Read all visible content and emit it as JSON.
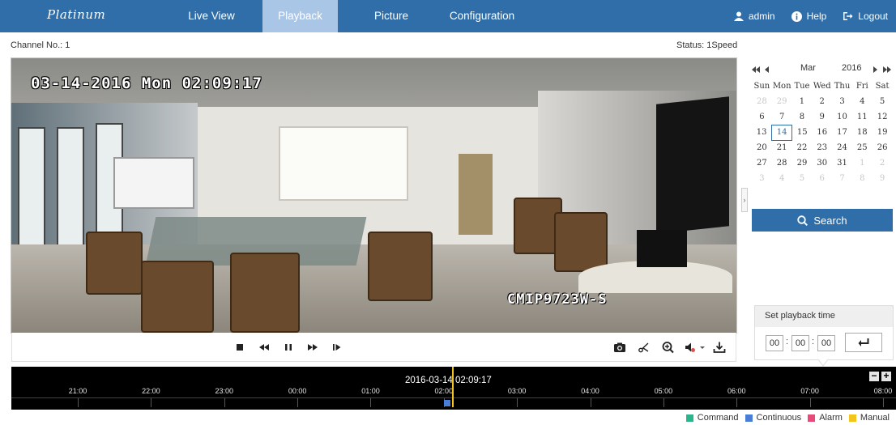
{
  "brand": {
    "logo_text": "Platinum"
  },
  "nav": {
    "tabs": [
      {
        "label": "Live View"
      },
      {
        "label": "Playback"
      },
      {
        "label": "Picture"
      },
      {
        "label": "Configuration"
      }
    ],
    "active": "Playback",
    "user": "admin",
    "help": "Help",
    "logout": "Logout",
    "icons": {
      "user": "user-icon",
      "help": "info-icon",
      "logout": "logout-icon"
    }
  },
  "status_row": {
    "channel": "Channel No.: 1",
    "status": "Status: 1Speed"
  },
  "video": {
    "osd_timestamp": "03-14-2016 Mon 02:09:17",
    "osd_camera": "CMIP9723W-S"
  },
  "controls": {
    "left_icons": [
      "stop-icon",
      "rewind-icon",
      "pause-icon",
      "fast-forward-icon",
      "single-frame-icon"
    ],
    "right_icons": [
      "capture-icon",
      "clip-icon",
      "digital-zoom-icon",
      "volume-icon",
      "download-icon"
    ]
  },
  "calendar": {
    "month": "Mar",
    "year": "2016",
    "weekdays": [
      "Sun",
      "Mon",
      "Tue",
      "Wed",
      "Thu",
      "Fri",
      "Sat"
    ],
    "weeks": [
      [
        "28",
        "29",
        "1",
        "2",
        "3",
        "4",
        "5"
      ],
      [
        "6",
        "7",
        "8",
        "9",
        "10",
        "11",
        "12"
      ],
      [
        "13",
        "14",
        "15",
        "16",
        "17",
        "18",
        "19"
      ],
      [
        "20",
        "21",
        "22",
        "23",
        "24",
        "25",
        "26"
      ],
      [
        "27",
        "28",
        "29",
        "30",
        "31",
        "1",
        "2"
      ],
      [
        "3",
        "4",
        "5",
        "6",
        "7",
        "8",
        "9"
      ]
    ],
    "selected_day": "14",
    "search_label": "Search"
  },
  "playback_time": {
    "title": "Set playback time",
    "hours": "00",
    "minutes": "00",
    "seconds": "00"
  },
  "timeline": {
    "current": "2016-03-14 02:09:17",
    "labels": [
      "21:00",
      "22:00",
      "23:00",
      "00:00",
      "01:00",
      "02:00",
      "03:00",
      "04:00",
      "05:00",
      "06:00",
      "07:00",
      "08:00"
    ]
  },
  "legend": [
    {
      "label": "Command",
      "color": "#2bb58a"
    },
    {
      "label": "Continuous",
      "color": "#4a7ed6"
    },
    {
      "label": "Alarm",
      "color": "#e84a7a"
    },
    {
      "label": "Manual",
      "color": "#f2c41c"
    }
  ],
  "colors": {
    "nav_bg": "#2f6ea8",
    "active_tab": "#aac6e6",
    "accent": "#2f6ea8"
  }
}
